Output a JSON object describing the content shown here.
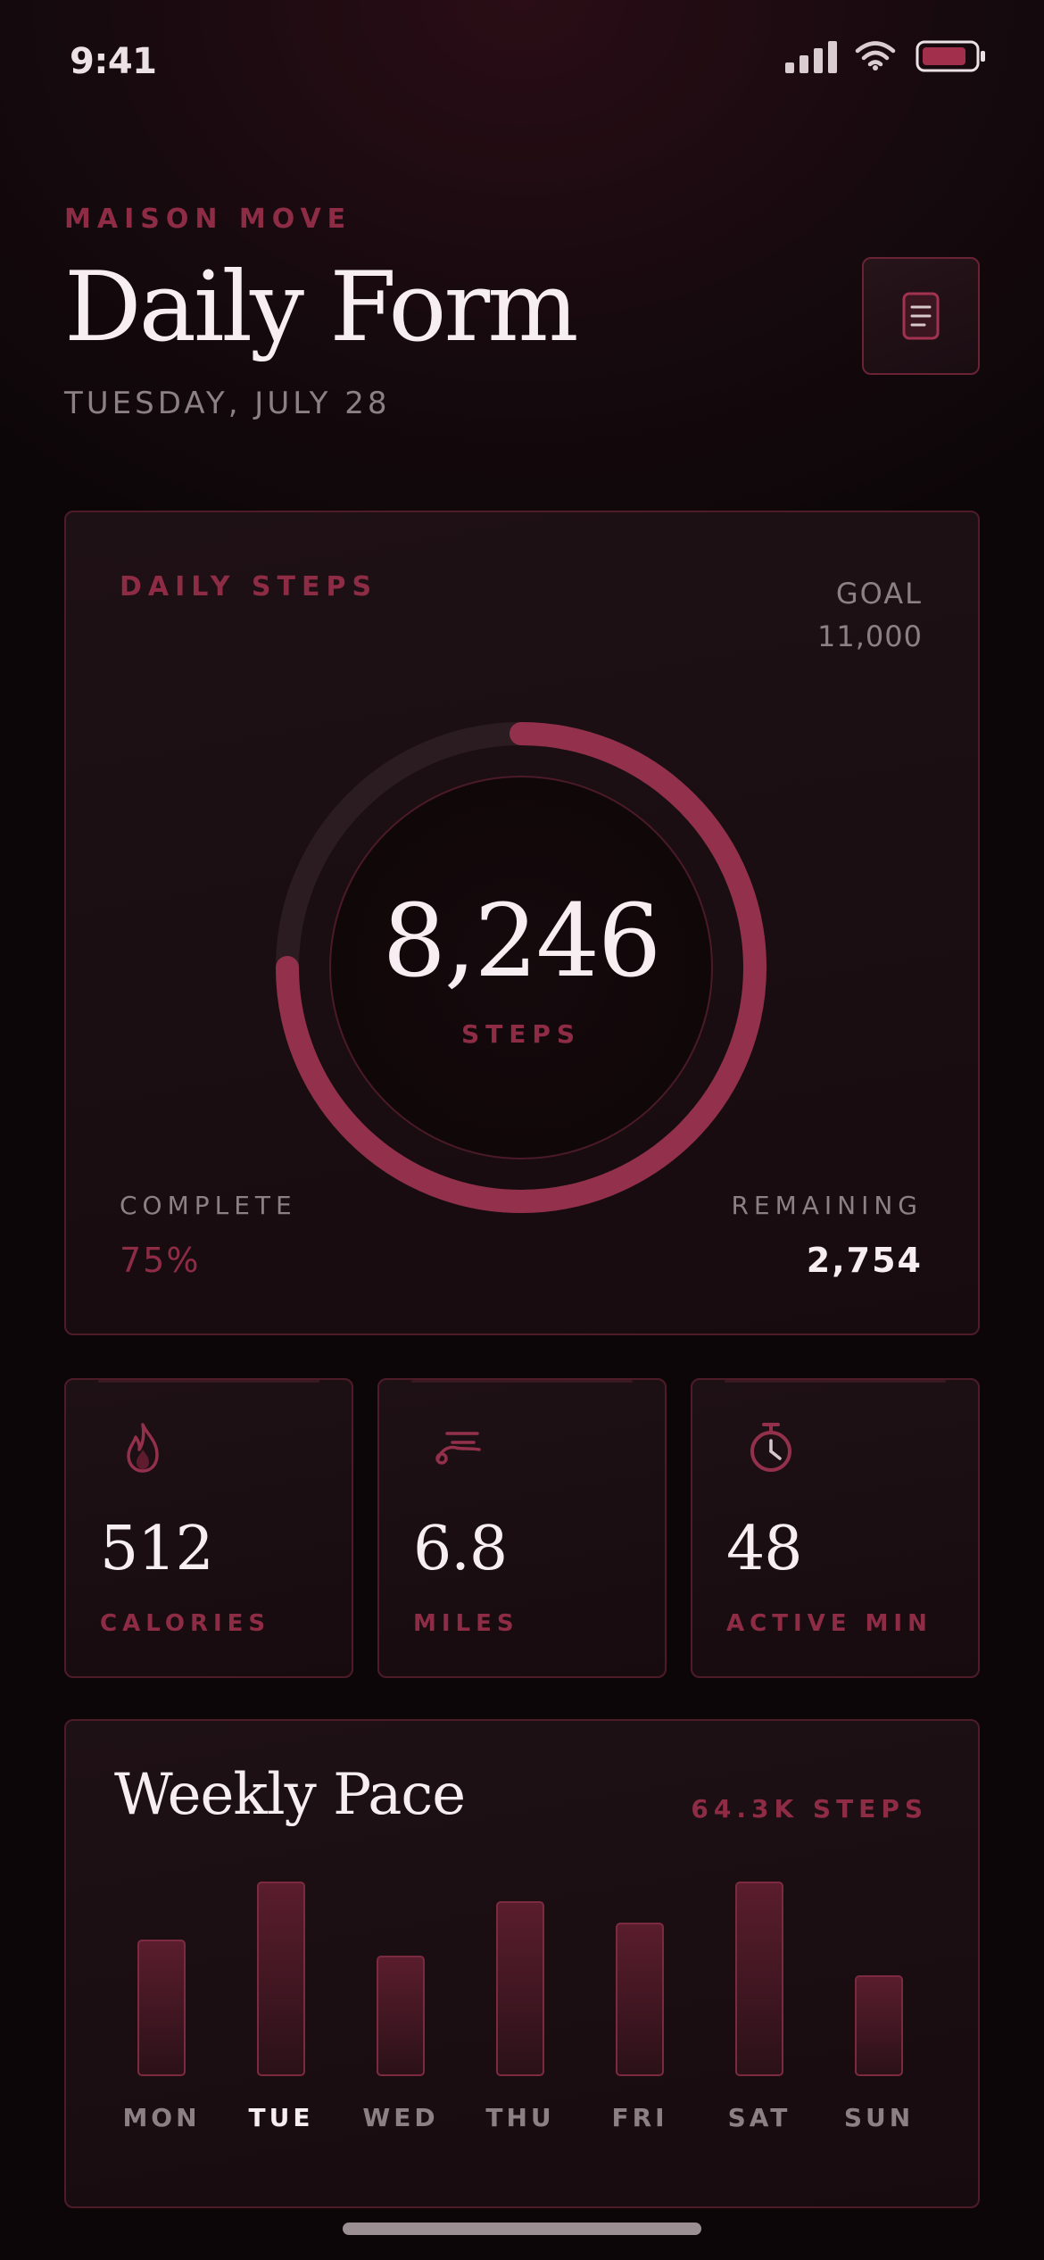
{
  "status_bar": {
    "time": "9:41"
  },
  "header": {
    "brand": "MAISON MOVE",
    "title": "Daily Form",
    "date": "TUESDAY, JULY 28"
  },
  "steps_card": {
    "label": "DAILY STEPS",
    "goal_label": "GOAL",
    "goal_value": "11,000",
    "steps_value": "8,246",
    "steps_unit": "STEPS",
    "progress_fraction": 0.75,
    "complete_label": "COMPLETE",
    "complete_value": "75%",
    "remaining_label": "REMAINING",
    "remaining_value": "2,754"
  },
  "stats": [
    {
      "value": "512",
      "label": "CALORIES",
      "icon": "flame-icon"
    },
    {
      "value": "6.8",
      "label": "MILES",
      "icon": "sneaker-icon"
    },
    {
      "value": "48",
      "label": "ACTIVE MIN",
      "icon": "stopwatch-icon"
    }
  ],
  "weekly": {
    "title": "Weekly Pace",
    "total": "64.3K STEPS",
    "selected_day": "TUE",
    "chart_data": {
      "type": "bar",
      "categories": [
        "MON",
        "TUE",
        "WED",
        "THU",
        "FRI",
        "SAT",
        "SUN"
      ],
      "values": [
        0.7,
        1.0,
        0.62,
        0.9,
        0.79,
        1.0,
        0.52
      ]
    }
  },
  "colors": {
    "accent": "#8e2c45",
    "ring_track": "#2f1f24",
    "text_primary": "#f6eef1",
    "text_muted": "#8d8084"
  }
}
